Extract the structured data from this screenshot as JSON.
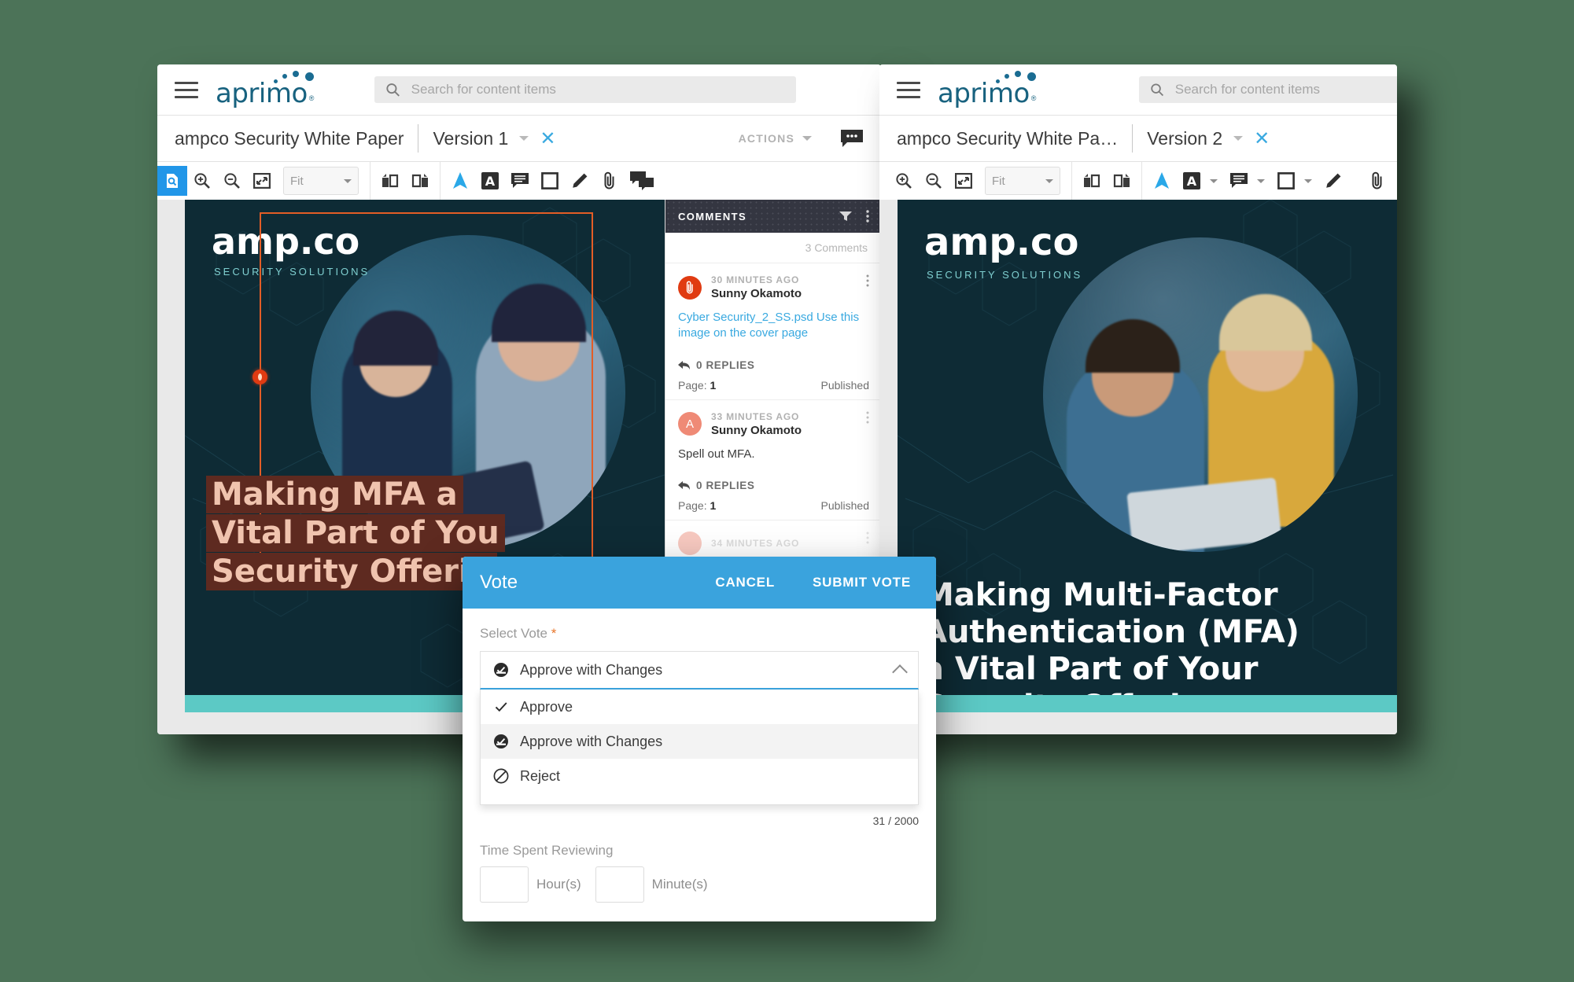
{
  "page": {
    "background_color": "#4c7358"
  },
  "brand": {
    "name": "aprimo",
    "color": "#18627f",
    "dot_color": "#1a6c92"
  },
  "search": {
    "placeholder": "Search for content items",
    "value": "",
    "icon": "search-icon"
  },
  "window_left": {
    "doc_title": "ampco Security White Paper",
    "version": "Version 1",
    "actions_label": "ACTIONS",
    "close_icon": "close-icon",
    "comments_bubble_icon": "comments-bubble-icon",
    "toolbar": {
      "zoom_label": "Fit",
      "items": [
        {
          "name": "document-search-icon",
          "active": true
        },
        {
          "name": "zoom-in-icon",
          "active": false
        },
        {
          "name": "zoom-out-icon",
          "active": false
        },
        {
          "name": "fit-to-screen-icon",
          "active": false
        },
        {
          "name": "rotate-left-icon",
          "active": false
        },
        {
          "name": "rotate-right-icon",
          "active": false
        },
        {
          "name": "pointer-icon",
          "active": false
        },
        {
          "name": "text-annotation-icon",
          "active": false
        },
        {
          "name": "note-annotation-icon",
          "active": false
        },
        {
          "name": "rectangle-annotation-icon",
          "active": false
        },
        {
          "name": "pencil-annotation-icon",
          "active": false
        },
        {
          "name": "attachment-icon",
          "active": false
        },
        {
          "name": "comment-annotation-icon",
          "active": false
        }
      ]
    },
    "cover": {
      "logo": "amp.co",
      "subtitle": "SECURITY SOLUTIONS",
      "headline_lines": [
        "Making MFA a",
        "Vital Part of You",
        "Security Offerin"
      ]
    }
  },
  "window_right": {
    "doc_title": "ampco Security White Pa…",
    "version": "Version 2",
    "close_icon": "close-icon",
    "toolbar": {
      "zoom_label": "Fit",
      "items": [
        {
          "name": "zoom-in-icon",
          "active": false
        },
        {
          "name": "zoom-out-icon",
          "active": false
        },
        {
          "name": "fit-to-screen-icon",
          "active": false
        },
        {
          "name": "rotate-left-icon",
          "active": false
        },
        {
          "name": "rotate-right-icon",
          "active": false
        },
        {
          "name": "pointer-icon",
          "active": false
        },
        {
          "name": "text-annotation-icon",
          "active": false
        },
        {
          "name": "note-annotation-icon",
          "active": false
        },
        {
          "name": "rectangle-annotation-icon",
          "active": false
        },
        {
          "name": "pencil-annotation-icon",
          "active": false
        },
        {
          "name": "attachment-icon",
          "active": false
        }
      ]
    },
    "cover": {
      "logo": "amp.co",
      "subtitle": "SECURITY SOLUTIONS",
      "headline_lines": [
        "Making Multi-Factor",
        "Authentication (MFA)",
        "a Vital Part of Your",
        "Security Offering"
      ]
    }
  },
  "comments": {
    "header": "COMMENTS",
    "filter_icon": "filter-icon",
    "menu_icon": "kebab-menu-icon",
    "count_label": "3 Comments",
    "items": [
      {
        "avatar_type": "attachment",
        "avatar_letter": "",
        "time": "30 MINUTES AGO",
        "author": "Sunny Okamoto",
        "body": "Cyber Security_2_SS.psd Use this image on the cover page",
        "is_link": true,
        "replies": "0 REPLIES",
        "page_label": "Page:",
        "page_value": "1",
        "status": "Published"
      },
      {
        "avatar_type": "letter",
        "avatar_letter": "A",
        "time": "33 MINUTES AGO",
        "author": "Sunny Okamoto",
        "body": "Spell out MFA.",
        "is_link": false,
        "replies": "0 REPLIES",
        "page_label": "Page:",
        "page_value": "1",
        "status": "Published"
      },
      {
        "avatar_type": "letter",
        "avatar_letter": "",
        "time": "34 MINUTES AGO",
        "author": "",
        "body": "",
        "is_link": false,
        "replies": "",
        "page_label": "",
        "page_value": "",
        "status": ""
      }
    ]
  },
  "vote_dialog": {
    "title": "Vote",
    "cancel_label": "CANCEL",
    "submit_label": "SUBMIT VOTE",
    "field_label": "Select Vote",
    "required_mark": "*",
    "selected_value": "Approve with Changes",
    "selected_icon": "approve-with-changes-icon",
    "options": [
      {
        "label": "Approve",
        "icon": "check-icon",
        "selected": false
      },
      {
        "label": "Approve with Changes",
        "icon": "approve-with-changes-icon",
        "selected": true
      },
      {
        "label": "Reject",
        "icon": "reject-icon",
        "selected": false
      }
    ],
    "char_counter": "31 / 2000",
    "time_label": "Time Spent Reviewing",
    "hours_value": "",
    "hours_unit": "Hour(s)",
    "minutes_value": "",
    "minutes_unit": "Minute(s)",
    "accent_color": "#3aa3dd"
  }
}
